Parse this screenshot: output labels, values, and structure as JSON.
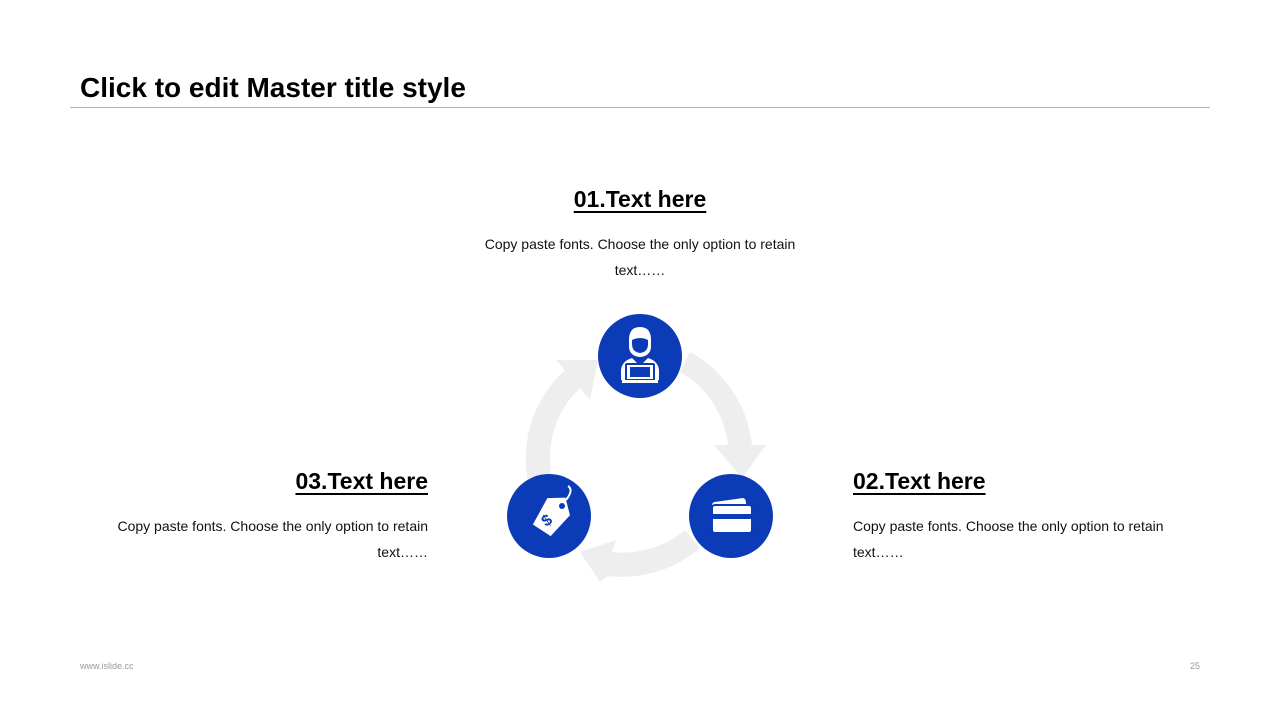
{
  "slide": {
    "title": "Click to edit Master title style",
    "footer_left": "www.islide.cc",
    "page_number": "25"
  },
  "items": [
    {
      "heading": "01.Text here",
      "body": "Copy paste fonts. Choose the only option to retain text……",
      "icon": "user-laptop-icon"
    },
    {
      "heading": "02.Text here",
      "body": "Copy paste fonts. Choose the only option to retain text……",
      "icon": "credit-card-icon"
    },
    {
      "heading": "03.Text here",
      "body": "Copy paste fonts. Choose the only option to retain text……",
      "icon": "price-tag-icon"
    }
  ],
  "colors": {
    "accent": "#0b3bb7",
    "arrow": "#eeeeee",
    "rule": "#b4b4b4",
    "footer": "#9a9a9a"
  }
}
